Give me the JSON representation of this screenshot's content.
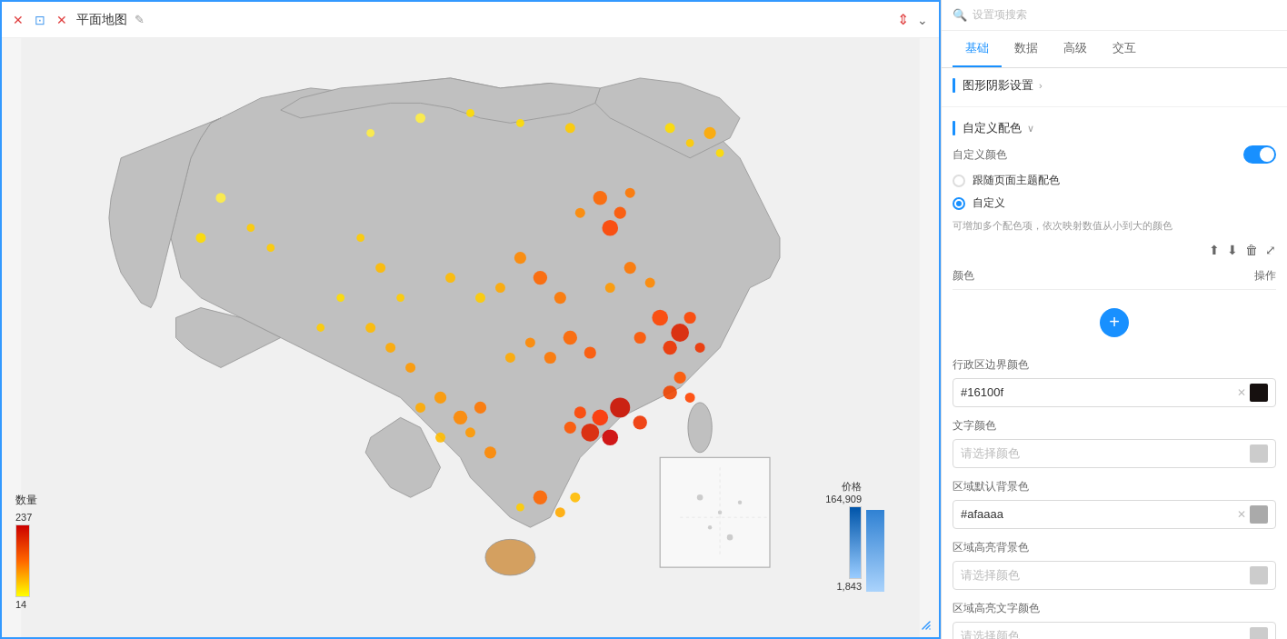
{
  "map_panel": {
    "title": "平面地图",
    "toolbar_icons": {
      "close": "✕",
      "resize": "⊡",
      "x_close": "✕",
      "edit": "✎",
      "sort": "≡",
      "expand": "⌄"
    }
  },
  "legend": {
    "quantity_label": "数量",
    "quantity_max": "237",
    "quantity_min": "14",
    "price_label": "价格",
    "price_max": "164,909",
    "price_min": "1,843"
  },
  "right_panel": {
    "search_placeholder": "设置项搜索",
    "tabs": [
      {
        "label": "基础",
        "active": true
      },
      {
        "label": "数据",
        "active": false
      },
      {
        "label": "高级",
        "active": false
      },
      {
        "label": "交互",
        "active": false
      }
    ],
    "section1": {
      "title": "图形阴影设置",
      "has_arrow": true
    },
    "section2": {
      "title": "自定义配色",
      "has_dropdown": true
    },
    "custom_color": {
      "toggle_label": "自定义颜色",
      "radio1_label": "跟随页面主题配色",
      "radio2_label": "自定义",
      "hint": "可增加多个配色项，依次映射数值从小到大的颜色",
      "color_table_header_color": "颜色",
      "color_table_header_op": "操作",
      "add_btn": "+",
      "border_color_label": "行政区边界颜色",
      "border_color_value": "#16100f",
      "text_color_label": "文字颜色",
      "text_color_placeholder": "请选择颜色",
      "default_bg_label": "区域默认背景色",
      "default_bg_value": "#afaaaa",
      "highlight_bg_label": "区域高亮背景色",
      "highlight_bg_placeholder": "请选择颜色",
      "highlight_text_label": "区域高亮文字颜色",
      "highlight_text_placeholder": "请选择颜色"
    }
  }
}
